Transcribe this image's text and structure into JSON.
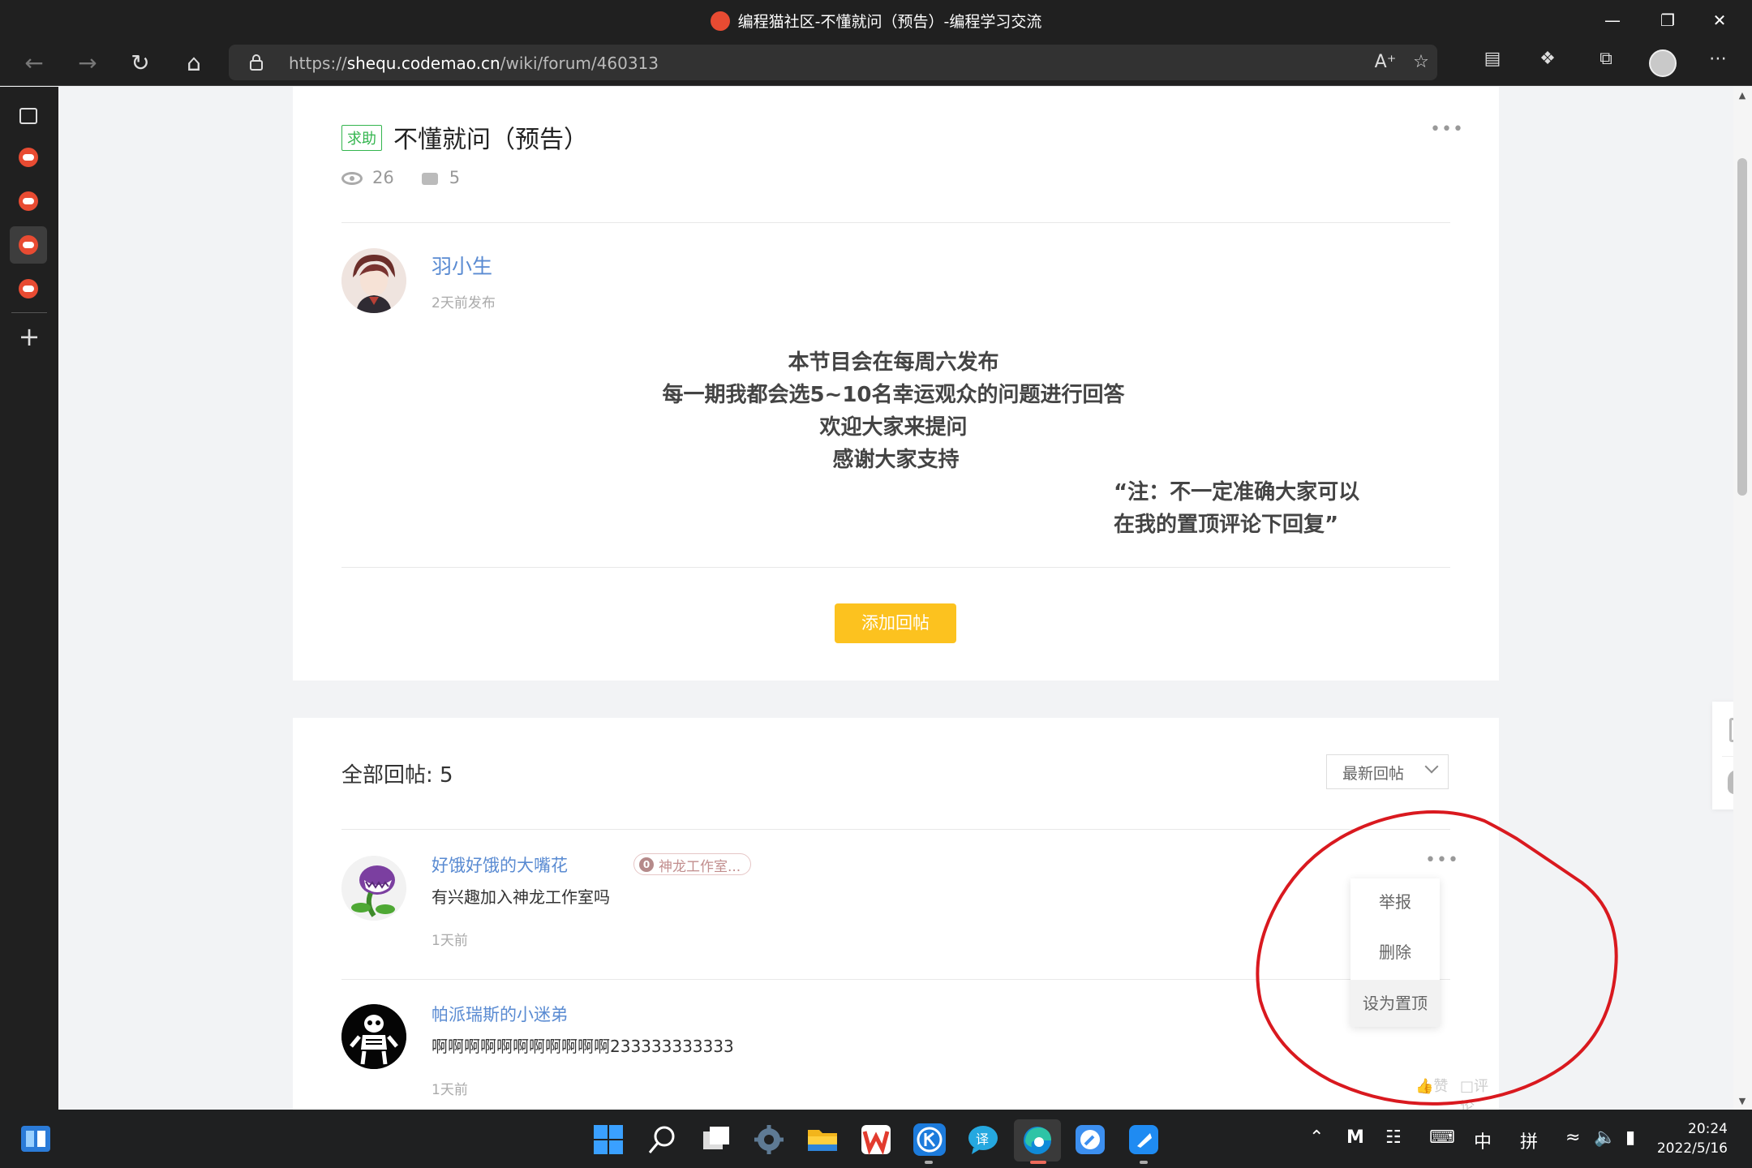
{
  "window": {
    "title": "编程猫社区-不懂就问（预告）-编程学习交流"
  },
  "browser": {
    "url_prefix": "https://",
    "url_host": "shequ.codemao.cn",
    "url_path": "/wiki/forum/460313",
    "accent": "#202020"
  },
  "post": {
    "tag": "求助",
    "title": "不懂就问（预告）",
    "views": "26",
    "comments": "5",
    "author": "羽小生",
    "published": "2天前发布",
    "body_lines": [
      "本节目会在每周六发布",
      "每一期我都会选5~10名幸运观众的问题进行回答",
      "欢迎大家来提问",
      "感谢大家支持"
    ],
    "note_lines": [
      "“注：不一定准确大家可以",
      "在我的置顶评论下回复”"
    ],
    "add_reply_label": "添加回帖",
    "add_reply_color": "#fcc21f"
  },
  "replies": {
    "header": "全部回帖: 5",
    "sort_label": "最新回帖",
    "items": [
      {
        "name": "好饿好饿的大嘴花",
        "badge": "神龙工作室...",
        "badge_level": "0",
        "text": "有兴趣加入神龙工作室吗",
        "time": "1天前"
      },
      {
        "name": "帕派瑞斯的小迷弟",
        "text": "啊啊啊啊啊啊啊啊啊啊啊233333333333",
        "time": "1天前",
        "like_label": "赞",
        "comment_label": "评论"
      }
    ],
    "menu": {
      "report": "举报",
      "delete": "删除",
      "pin": "设为置顶"
    }
  },
  "taskbar": {
    "time": "20:24",
    "date": "2022/5/16",
    "ime_lang": "中",
    "ime_mode": "拼"
  },
  "annotation_color": "#d9191f"
}
